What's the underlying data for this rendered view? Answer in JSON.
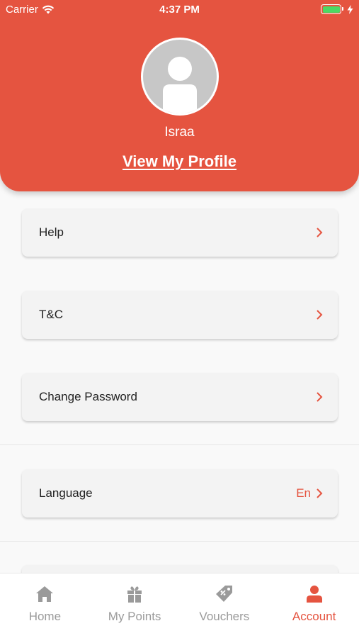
{
  "status_bar": {
    "carrier": "Carrier",
    "time": "4:37 PM"
  },
  "profile": {
    "name": "Israa",
    "view_profile_label": "View My Profile"
  },
  "menu": {
    "help": "Help",
    "terms": "T&C",
    "change_password": "Change Password",
    "language": {
      "label": "Language",
      "value": "En"
    }
  },
  "nav": {
    "items": [
      {
        "label": "Home",
        "icon": "home-icon"
      },
      {
        "label": "My Points",
        "icon": "gift-icon"
      },
      {
        "label": "Vouchers",
        "icon": "voucher-tag-icon"
      },
      {
        "label": "Account",
        "icon": "person-icon"
      }
    ],
    "active": "Account"
  },
  "colors": {
    "accent": "#e55440",
    "inactive": "#9a9a9a",
    "battery": "#4cd964"
  }
}
